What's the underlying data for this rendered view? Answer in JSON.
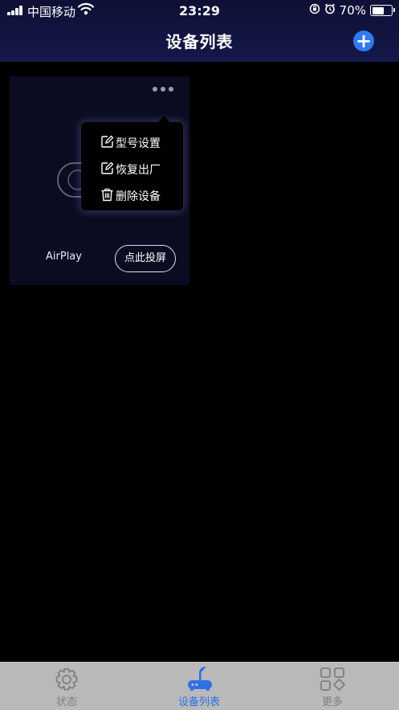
{
  "status_bar": {
    "carrier": "中国移动",
    "time": "23:29",
    "battery_percent": "70%",
    "battery_level": 0.7
  },
  "nav": {
    "title": "设备列表",
    "add_icon": "plus-circle-icon"
  },
  "device_card": {
    "name": "AirPlay",
    "cast_button": "点此投屏",
    "more_icon": "more-dots-icon",
    "graphic_icon": "airplay-toggle-icon"
  },
  "popup_menu": {
    "items": [
      {
        "label": "型号设置",
        "icon": "edit-icon"
      },
      {
        "label": "恢复出厂",
        "icon": "edit-icon"
      },
      {
        "label": "删除设备",
        "icon": "trash-icon"
      }
    ]
  },
  "tabbar": {
    "tabs": [
      {
        "label": "状态",
        "icon": "gear-icon",
        "active": false
      },
      {
        "label": "设备列表",
        "icon": "router-icon",
        "active": true
      },
      {
        "label": "更多",
        "icon": "grid-icon",
        "active": false
      }
    ]
  },
  "colors": {
    "accent": "#2f7bf2",
    "nav_bg": "#15184a",
    "tab_active": "#2f6fe8",
    "tab_inactive": "#7f7f7f",
    "tabbar_bg": "#b9b9b9"
  }
}
